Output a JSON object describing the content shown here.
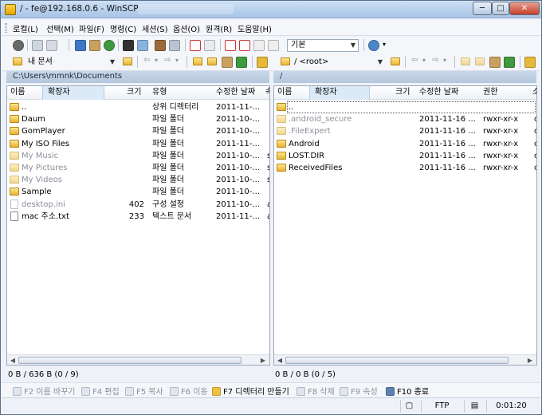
{
  "window": {
    "title": "/ - fe@192.168.0.6 - WinSCP",
    "controls": {
      "minimize": "─",
      "maximize": "□",
      "close": "✕"
    }
  },
  "menu": [
    "로컬(L)",
    "선택(M)",
    "파일(F)",
    "명령(C)",
    "세션(S)",
    "옵션(O)",
    "원격(R)",
    "도움말(H)"
  ],
  "toolbar": {
    "profile": "기본"
  },
  "left": {
    "location": "내 문서",
    "path": "C:\\Users\\mmnk\\Documents",
    "columns": [
      "이름",
      "확장자",
      "크기",
      "유형",
      "수정한 날짜",
      "속"
    ],
    "rows": [
      {
        "name": "..",
        "size": "",
        "type": "상위 디렉터리",
        "date": "2011-11-...",
        "attr": "",
        "icon": "up",
        "dim": false
      },
      {
        "name": "Daum",
        "size": "",
        "type": "파일 폴더",
        "date": "2011-10-...",
        "attr": "",
        "icon": "folder",
        "dim": false
      },
      {
        "name": "GomPlayer",
        "size": "",
        "type": "파일 폴더",
        "date": "2011-10-...",
        "attr": "",
        "icon": "folder",
        "dim": false
      },
      {
        "name": "My ISO Files",
        "size": "",
        "type": "파일 폴더",
        "date": "2011-11-...",
        "attr": "",
        "icon": "folder",
        "dim": false
      },
      {
        "name": "My Music",
        "size": "",
        "type": "파일 폴더",
        "date": "2011-10-...",
        "attr": "s",
        "icon": "folder",
        "dim": true
      },
      {
        "name": "My Pictures",
        "size": "",
        "type": "파일 폴더",
        "date": "2011-10-...",
        "attr": "s",
        "icon": "folder",
        "dim": true
      },
      {
        "name": "My Videos",
        "size": "",
        "type": "파일 폴더",
        "date": "2011-10-...",
        "attr": "s",
        "icon": "folder",
        "dim": true
      },
      {
        "name": "Sample",
        "size": "",
        "type": "파일 폴더",
        "date": "2011-10-...",
        "attr": "",
        "icon": "folder",
        "dim": false
      },
      {
        "name": "desktop.ini",
        "size": "402",
        "type": "구성 설정",
        "date": "2011-10-...",
        "attr": "a",
        "icon": "file",
        "dim": true
      },
      {
        "name": "mac 주소.txt",
        "size": "233",
        "type": "텍스트 문서",
        "date": "2011-11-...",
        "attr": "a",
        "icon": "file",
        "dim": false
      }
    ],
    "status": "0 B / 636 B (0 / 9)"
  },
  "right": {
    "location": "/ <root>",
    "path": "/",
    "columns": [
      "이름",
      "확장자",
      "크기",
      "수정한 날짜",
      "권한",
      "소"
    ],
    "rows": [
      {
        "name": "..",
        "date": "",
        "perm": "",
        "owner": "",
        "icon": "up",
        "dim": false
      },
      {
        "name": ".android_secure",
        "date": "2011-11-16 ...",
        "perm": "rwxr-xr-x",
        "owner": "c",
        "icon": "folder",
        "dim": true
      },
      {
        "name": ".FileExpert",
        "date": "2011-11-16 ...",
        "perm": "rwxr-xr-x",
        "owner": "c",
        "icon": "folder",
        "dim": true
      },
      {
        "name": "Android",
        "date": "2011-11-16 ...",
        "perm": "rwxr-xr-x",
        "owner": "c",
        "icon": "folder",
        "dim": false
      },
      {
        "name": "LOST.DIR",
        "date": "2011-11-16 ...",
        "perm": "rwxr-xr-x",
        "owner": "c",
        "icon": "folder",
        "dim": false
      },
      {
        "name": "ReceivedFiles",
        "date": "2011-11-16 ...",
        "perm": "rwxr-xr-x",
        "owner": "c",
        "icon": "folder",
        "dim": false
      }
    ],
    "status": "0 B / 0 B (0 / 5)"
  },
  "fkeys": [
    {
      "label": "F2 이름 바꾸기",
      "enabled": false
    },
    {
      "label": "F4 편집",
      "enabled": false
    },
    {
      "label": "F5 복사",
      "enabled": false
    },
    {
      "label": "F6 이동",
      "enabled": false
    },
    {
      "label": "F7 디렉터리 만들기",
      "enabled": true
    },
    {
      "label": "F8 삭제",
      "enabled": false
    },
    {
      "label": "F9 속성",
      "enabled": false
    },
    {
      "label": "F10 종료",
      "enabled": true
    }
  ],
  "bottom": {
    "protocol": "FTP",
    "elapsed": "0:01:20"
  }
}
